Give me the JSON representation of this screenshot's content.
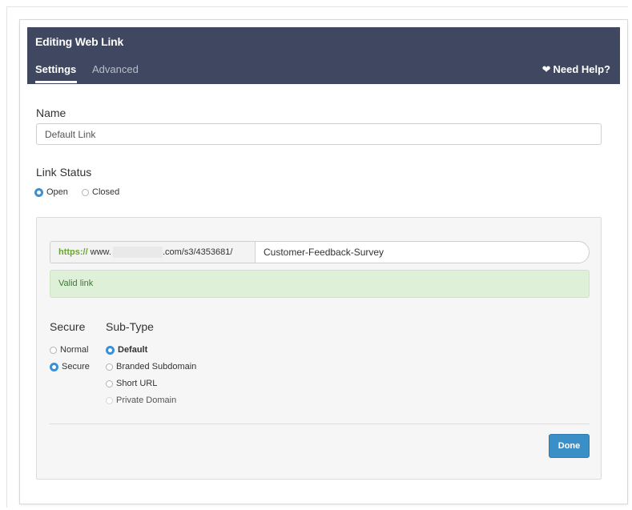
{
  "header": {
    "title": "Editing Web Link",
    "tabs": [
      {
        "label": "Settings",
        "active": true
      },
      {
        "label": "Advanced",
        "active": false
      }
    ],
    "help_label": "Need Help?",
    "help_icon": "heart-icon",
    "background_color": "#3f4860"
  },
  "name_section": {
    "label": "Name",
    "value": "Default Link"
  },
  "link_status": {
    "label": "Link Status",
    "options": [
      {
        "label": "Open",
        "selected": true
      },
      {
        "label": "Closed",
        "selected": false
      }
    ]
  },
  "url": {
    "scheme": "https://",
    "host_start": "www.",
    "host_end_path": ".com/s3/4353681/",
    "slug": "Customer-Feedback-Survey"
  },
  "validation": {
    "message": "Valid link",
    "color": "#dff0d8"
  },
  "secure": {
    "label": "Secure",
    "options": [
      {
        "label": "Normal",
        "selected": false
      },
      {
        "label": "Secure",
        "selected": true
      }
    ]
  },
  "sub_type": {
    "label": "Sub-Type",
    "options": [
      {
        "label": "Default",
        "selected": true,
        "enabled": true
      },
      {
        "label": "Branded Subdomain",
        "selected": false,
        "enabled": true
      },
      {
        "label": "Short URL",
        "selected": false,
        "enabled": true
      },
      {
        "label": "Private Domain",
        "selected": false,
        "enabled": false
      }
    ]
  },
  "actions": {
    "done_label": "Done",
    "accent_color": "#3a8fc6"
  }
}
